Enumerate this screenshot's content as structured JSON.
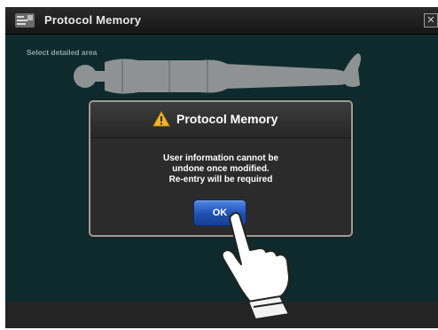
{
  "window": {
    "title": "Protocol Memory",
    "icons": {
      "app": "protocol-icon",
      "close": "close-icon"
    }
  },
  "main": {
    "hint": "Select detailed area"
  },
  "dialog": {
    "title": "Protocol Memory",
    "icon": "warning-icon",
    "message_lines": [
      "User information cannot be",
      "undone once modified.",
      "Re-entry will be required"
    ],
    "ok_label": "OK"
  },
  "colors": {
    "screen_bg": "#0e2a2c",
    "titlebar": "#1e1e1e",
    "dialog_bg": "#2b2b2b",
    "accent_button": "#2a5cc4",
    "warning": "#f0b42a"
  }
}
